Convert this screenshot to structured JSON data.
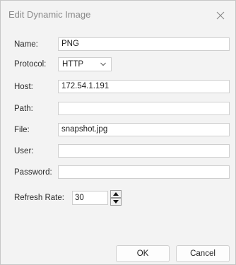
{
  "window": {
    "title": "Edit Dynamic Image",
    "close_icon": "close-icon"
  },
  "form": {
    "name": {
      "label": "Name:",
      "value": "PNG"
    },
    "protocol": {
      "label": "Protocol:",
      "value": "HTTP",
      "icon": "chevron-down-icon"
    },
    "host": {
      "label": "Host:",
      "value": "172.54.1.191"
    },
    "path": {
      "label": "Path:",
      "value": ""
    },
    "file": {
      "label": "File:",
      "value": "snapshot.jpg"
    },
    "user": {
      "label": "User:",
      "value": ""
    },
    "password": {
      "label": "Password:",
      "value": ""
    },
    "refresh_rate": {
      "label": "Refresh Rate:",
      "value": "30"
    }
  },
  "buttons": {
    "ok": "OK",
    "cancel": "Cancel"
  },
  "colors": {
    "dialog_background": "#f3f3f3",
    "field_background": "#ffffff",
    "title_text": "#8a8a8a"
  }
}
